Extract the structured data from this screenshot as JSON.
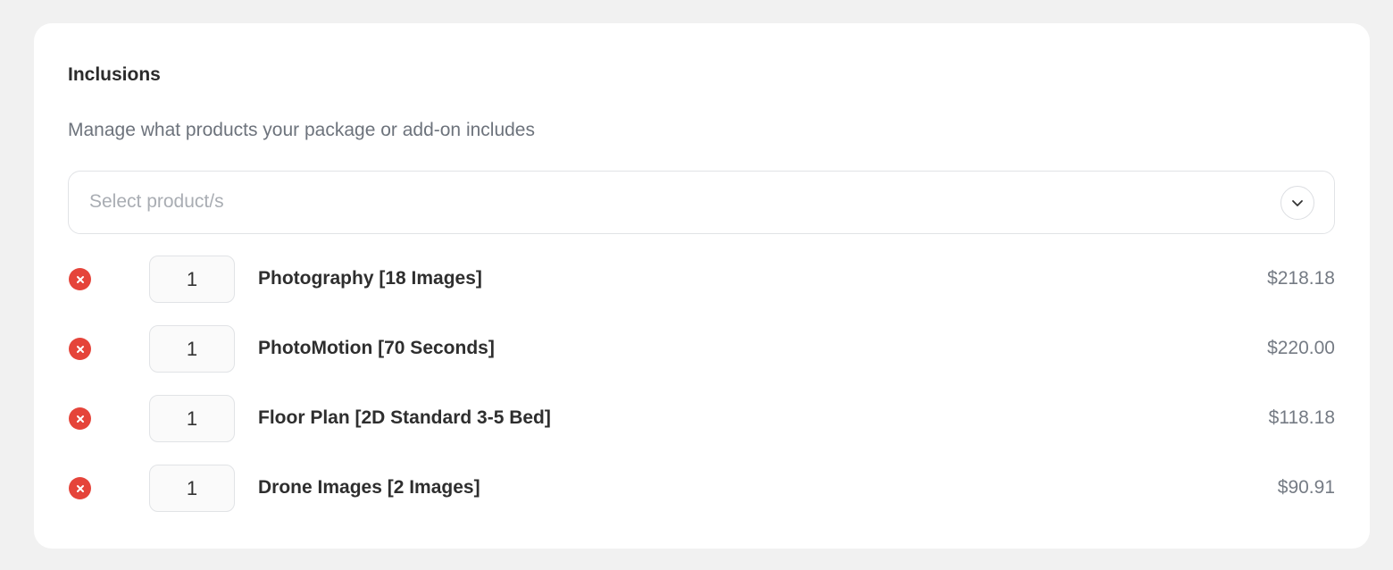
{
  "inclusions": {
    "title": "Inclusions",
    "description": "Manage what products your package or add-on includes",
    "select_placeholder": "Select product/s",
    "items": [
      {
        "qty": "1",
        "name": "Photography [18 Images]",
        "price": "$218.18"
      },
      {
        "qty": "1",
        "name": "PhotoMotion [70 Seconds]",
        "price": "$220.00"
      },
      {
        "qty": "1",
        "name": "Floor Plan [2D Standard 3-5 Bed]",
        "price": "$118.18"
      },
      {
        "qty": "1",
        "name": "Drone Images [2 Images]",
        "price": "$90.91"
      }
    ]
  },
  "colors": {
    "remove": "#e5443a",
    "background": "#f1f1f1",
    "card": "#ffffff"
  },
  "icons": {
    "remove": "close-circle-icon",
    "dropdown": "chevron-down-icon"
  }
}
